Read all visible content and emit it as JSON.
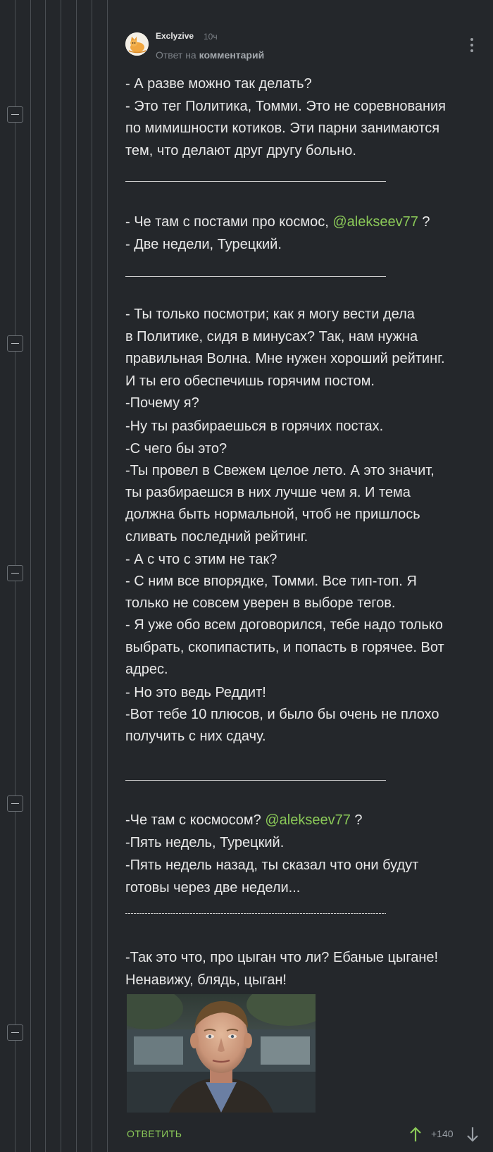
{
  "comment": {
    "author": "Exclyzive",
    "time": "10ч",
    "reply_prefix": "Ответ на",
    "reply_link": "комментарий",
    "avatar_icon": "avatar-cat-icon",
    "menu_icon": "more-vertical-icon"
  },
  "body": {
    "block1": {
      "l1": "- А разве можно так делать?",
      "l2": "- Это тег Политика, Томми. Это не соревнования",
      "l3": "по мимишности котиков. Эти парни занимаются",
      "l4": "тем, что делают друг другу больно."
    },
    "block2": {
      "l1_pre": "- Че там с постами про космос, ",
      "l1_mention": "@alekseev77",
      "l1_post": " ?",
      "l2": "- Две недели, Турецкий."
    },
    "block3": {
      "l1": "- Ты только посмотри; как я могу вести дела",
      "l2": "в Политике, сидя в минусах? Так, нам нужна",
      "l3": "правильная Волна. Мне нужен хороший рейтинг.",
      "l4": "И ты его обеспечишь горячим постом.",
      "l5": "-Почему я?",
      "l6": "-Ну ты разбираешься в горячих постах.",
      "l7": "-С чего бы это?",
      "l8": "-Ты провел в Свежем целое лето. А это значит,",
      "l9": "ты разбираешся в них лучше чем я. И тема",
      "l10": "должна быть нормальной, чтоб не пришлось",
      "l11": "сливать последний рейтинг.",
      "l12": "- А с что с этим не так?",
      "l13": "- С ним все впорядке, Томми. Все тип-топ. Я",
      "l14": "только не совсем уверен в выборе тегов.",
      "l15": "- Я уже обо всем договорился, тебе надо только",
      "l16": "выбрать, скопипастить, и попасть в горячее. Вот",
      "l17": "адрес.",
      "l18": "- Но это ведь Реддит!",
      "l19": "-Вот тебе 10 плюсов, и было бы очень не плохо",
      "l20": "получить с них сдачу."
    },
    "block4": {
      "l1_pre": "-Че там с космосом? ",
      "l1_mention": "@alekseev77",
      "l1_post": " ?",
      "l2": "-Пять недель, Турецкий.",
      "l3": "-Пять недель назад, ты сказал что они будут",
      "l4": "готовы через две недели..."
    },
    "block5": {
      "l1": "-Так это что, про цыган что ли? Ебаные цыгане!",
      "l2": "Ненавижу, блядь, цыган!"
    }
  },
  "footer": {
    "reply_label": "ОТВЕТИТЬ",
    "rating": "+140",
    "upvote_icon": "arrow-up-icon",
    "downvote_icon": "arrow-down-icon"
  },
  "colors": {
    "background": "#24272b",
    "accent": "#8ac858",
    "text": "#e8e8e8",
    "muted": "#7c8187"
  }
}
